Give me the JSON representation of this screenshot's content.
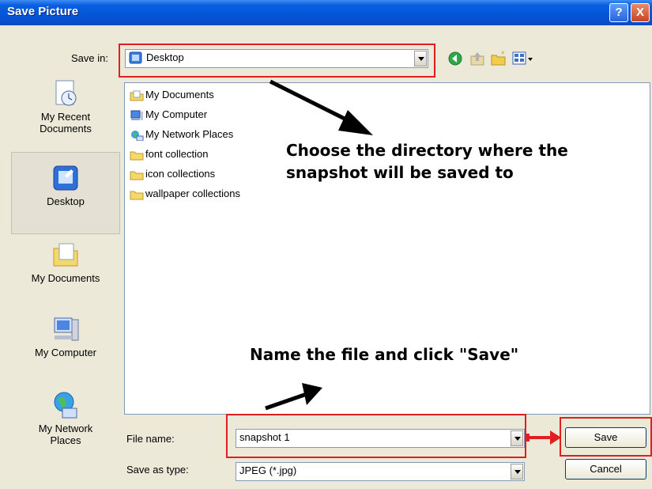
{
  "window": {
    "title": "Save Picture",
    "help_glyph": "?",
    "close_glyph": "X"
  },
  "toolbar": {
    "save_in_label": "Save in:",
    "save_in_value": "Desktop",
    "icons": [
      "back-icon",
      "up-folder-icon",
      "new-folder-icon",
      "views-menu-icon"
    ]
  },
  "places": [
    {
      "label": "My Recent Documents",
      "icon": "recent-documents-icon"
    },
    {
      "label": "Desktop",
      "icon": "desktop-icon"
    },
    {
      "label": "My Documents",
      "icon": "my-documents-icon"
    },
    {
      "label": "My Computer",
      "icon": "my-computer-icon"
    },
    {
      "label": "My Network Places",
      "icon": "network-places-icon"
    }
  ],
  "files": [
    {
      "name": "My Documents",
      "icon": "my-documents-icon"
    },
    {
      "name": "My Computer",
      "icon": "my-computer-icon"
    },
    {
      "name": "My Network Places",
      "icon": "network-places-icon"
    },
    {
      "name": "font collection",
      "icon": "folder-icon"
    },
    {
      "name": "icon collections",
      "icon": "folder-icon"
    },
    {
      "name": "wallpaper collections",
      "icon": "folder-icon"
    }
  ],
  "form": {
    "file_name_label": "File name:",
    "file_name_value": "snapshot 1",
    "save_as_type_label": "Save as type:",
    "save_as_type_value": "JPEG (*.jpg)"
  },
  "buttons": {
    "save": "Save",
    "cancel": "Cancel"
  },
  "annotations": {
    "directory_hint_line1": "Choose the directory where the",
    "directory_hint_line2": "snapshot will be saved to",
    "save_hint": "Name the file and click \"Save\"",
    "highlight_color": "#e02020"
  }
}
